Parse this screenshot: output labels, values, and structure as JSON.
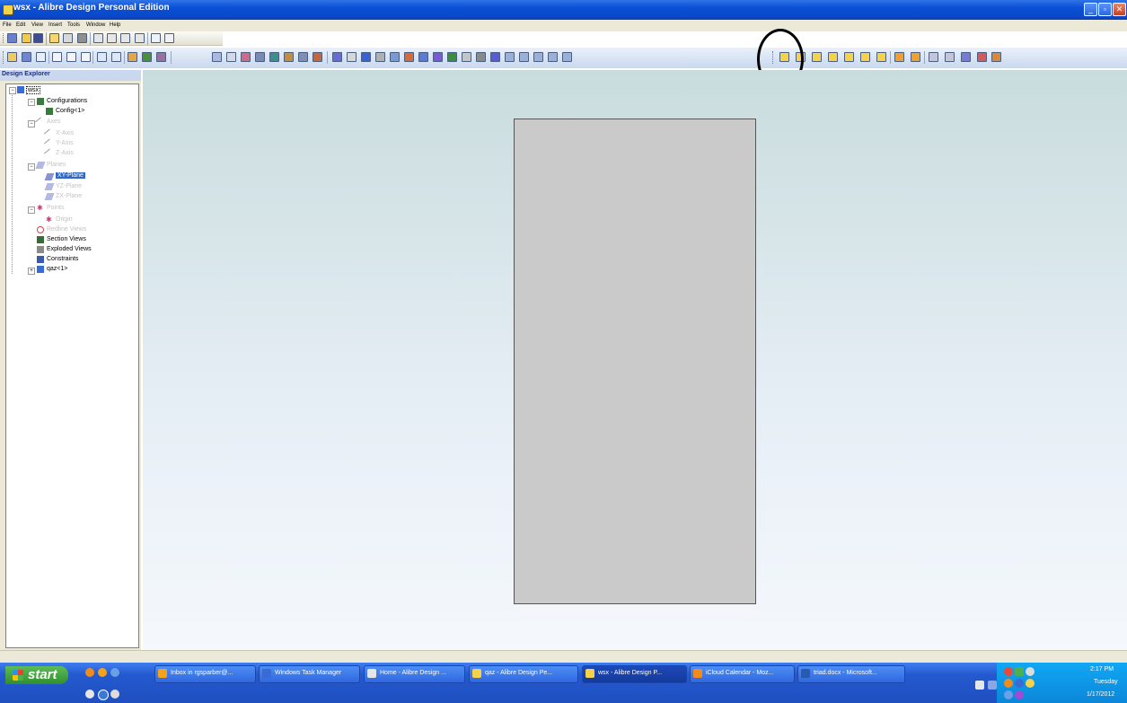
{
  "window": {
    "title": "wsx - Alibre Design Personal Edition",
    "controls": [
      "minimize",
      "maximize",
      "close"
    ]
  },
  "menu": [
    "File",
    "Edit",
    "View",
    "Insert",
    "Tools",
    "Window",
    "Help"
  ],
  "explorer": {
    "header": "Design Explorer",
    "tree": [
      {
        "label": "wsx",
        "icon": "part-icon",
        "state": "root"
      },
      {
        "label": "Configurations",
        "icon": "config-icon",
        "state": "normal"
      },
      {
        "label": "Config<1>",
        "icon": "config-icon",
        "state": "normal"
      },
      {
        "label": "Axes",
        "icon": "axis-icon",
        "state": "dim"
      },
      {
        "label": "X-Axis",
        "icon": "axis-icon",
        "state": "dim"
      },
      {
        "label": "Y-Axis",
        "icon": "axis-icon",
        "state": "dim"
      },
      {
        "label": "Z-Axis",
        "icon": "axis-icon",
        "state": "dim"
      },
      {
        "label": "Planes",
        "icon": "plane-icon",
        "state": "dim"
      },
      {
        "label": "XY-Plane",
        "icon": "plane-icon",
        "state": "selected"
      },
      {
        "label": "YZ-Plane",
        "icon": "plane-icon",
        "state": "dim"
      },
      {
        "label": "ZX-Plane",
        "icon": "plane-icon",
        "state": "dim"
      },
      {
        "label": "Points",
        "icon": "point-icon",
        "state": "dim"
      },
      {
        "label": "Origin",
        "icon": "point-icon",
        "state": "dim"
      },
      {
        "label": "Redline Views",
        "icon": "redline-icon",
        "state": "dim"
      },
      {
        "label": "Section Views",
        "icon": "section-icon",
        "state": "normal"
      },
      {
        "label": "Exploded Views",
        "icon": "exploded-icon",
        "state": "normal"
      },
      {
        "label": "Constraints",
        "icon": "constraint-icon",
        "state": "normal"
      },
      {
        "label": "qaz<1>",
        "icon": "part-icon",
        "state": "normal"
      }
    ]
  },
  "taskbar": {
    "start_label": "start",
    "tasks": [
      "Inbox in rgsparber@...",
      "Windows Task Manager",
      "Home - Alibre Design ...",
      "qaz - Alibre Design Pe...",
      "wsx - Alibre Design P...",
      "iCloud Calendar - Moz...",
      "triad.docx - Microsoft..."
    ],
    "active_task": "wsx - Alibre Design P..."
  },
  "clock": {
    "time": "2:17 PM",
    "day": "Tuesday",
    "date": "1/17/2012"
  },
  "colors": {
    "titlebar": "#0b4fd6",
    "canvas_top": "#c9dcdd",
    "canvas_bottom": "#f5f8fc",
    "plane_fill": "#cacaca",
    "selection": "#316ac5",
    "taskbar": "#2459cf",
    "start": "#318f2d"
  }
}
